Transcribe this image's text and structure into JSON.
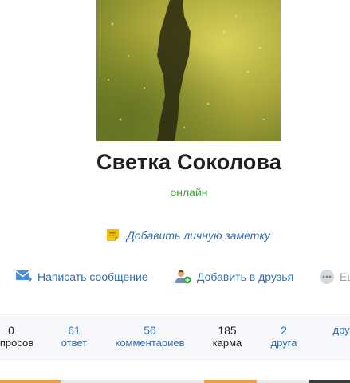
{
  "profile": {
    "name": "Светка Соколова",
    "status": "онлайн",
    "note_link": "Добавить личную заметку"
  },
  "actions": {
    "message": {
      "label": "Написать сообщение",
      "icon": "envelope-icon"
    },
    "add_friend": {
      "label": "Добавить в друзья",
      "icon": "add-friend-icon"
    },
    "more": {
      "label": "Еще",
      "icon": "more-dots-icon"
    }
  },
  "stats": [
    {
      "value": "0",
      "label": "вопросов"
    },
    {
      "value": "61",
      "label": "ответ"
    },
    {
      "value": "56",
      "label": "комментариев"
    },
    {
      "value": "185",
      "label": "карма"
    },
    {
      "value": "2",
      "label": "друга"
    },
    {
      "value": "",
      "label": "друзья"
    }
  ],
  "colors": {
    "link": "#2e6db4",
    "online": "#3aa83a",
    "note_icon": "#f2c200",
    "stats_bg": "#f6f8fb"
  }
}
